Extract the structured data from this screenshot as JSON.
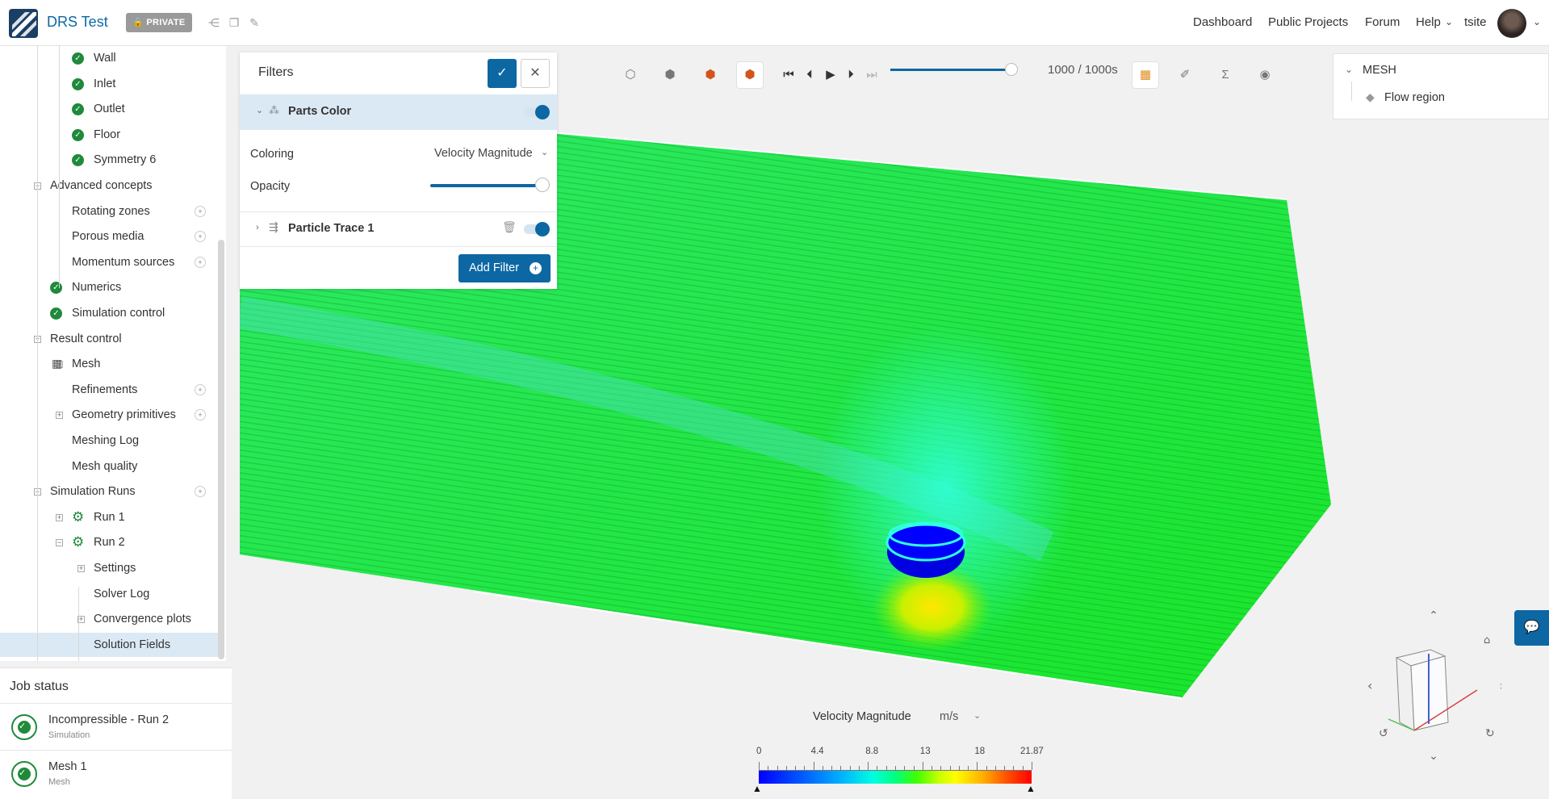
{
  "header": {
    "title": "DRS Test",
    "private_label": "PRIVATE",
    "nav": [
      "Dashboard",
      "Public Projects",
      "Forum",
      "Help"
    ],
    "user": "tsite"
  },
  "tree": {
    "items": [
      {
        "label": "Wall",
        "level": 3,
        "icon": "check"
      },
      {
        "label": "Inlet",
        "level": 3,
        "icon": "check"
      },
      {
        "label": "Outlet",
        "level": 3,
        "icon": "check"
      },
      {
        "label": "Floor",
        "level": 3,
        "icon": "check"
      },
      {
        "label": "Symmetry 6",
        "level": 3,
        "icon": "check"
      },
      {
        "label": "Advanced concepts",
        "level": 1,
        "toggle": "minus"
      },
      {
        "label": "Rotating zones",
        "level": 2,
        "add": true
      },
      {
        "label": "Porous media",
        "level": 2,
        "add": true
      },
      {
        "label": "Momentum sources",
        "level": 2,
        "add": true
      },
      {
        "label": "Numerics",
        "level": 2,
        "icon": "check"
      },
      {
        "label": "Simulation control",
        "level": 2,
        "icon": "check"
      },
      {
        "label": "Result control",
        "level": 1,
        "toggle": "plus"
      },
      {
        "label": "Mesh",
        "level": 2,
        "toggle": "minus",
        "icon": "mesh"
      },
      {
        "label": "Refinements",
        "level": 2,
        "add": true
      },
      {
        "label": "Geometry primitives",
        "level": 2,
        "toggle": "plus",
        "add": true
      },
      {
        "label": "Meshing Log",
        "level": 2
      },
      {
        "label": "Mesh quality",
        "level": 2
      },
      {
        "label": "Simulation Runs",
        "level": 1,
        "toggle": "minus",
        "add": true
      },
      {
        "label": "Run 1",
        "level": 3,
        "toggle": "plus",
        "icon": "gear"
      },
      {
        "label": "Run 2",
        "level": 3,
        "toggle": "minus",
        "icon": "gear"
      },
      {
        "label": "Settings",
        "level": 4,
        "toggle": "plus"
      },
      {
        "label": "Solver Log",
        "level": 4
      },
      {
        "label": "Convergence plots",
        "level": 4,
        "toggle": "plus"
      },
      {
        "label": "Solution Fields",
        "level": 4,
        "selected": true
      }
    ]
  },
  "jobs": {
    "title": "Job status",
    "items": [
      {
        "name": "Incompressible - Run 2",
        "type": "Simulation"
      },
      {
        "name": "Mesh 1",
        "type": "Mesh"
      }
    ]
  },
  "filters": {
    "title": "Filters",
    "parts_color": "Parts Color",
    "coloring_label": "Coloring",
    "coloring_value": "Velocity Magnitude",
    "opacity_label": "Opacity",
    "opacity_value": 1.0,
    "particle_trace": "Particle Trace 1",
    "add_filter": "Add Filter"
  },
  "playback": {
    "time": "1000 / 1000s",
    "progress": 1.0
  },
  "mesh_panel": {
    "header": "MESH",
    "item": "Flow region"
  },
  "legend": {
    "title": "Velocity Magnitude",
    "unit": "m/s",
    "ticks": [
      "0",
      "4.4",
      "8.8",
      "13",
      "18",
      "21.87"
    ]
  },
  "colors": {
    "accent": "#0d67a3",
    "success": "#1f8a3b"
  }
}
